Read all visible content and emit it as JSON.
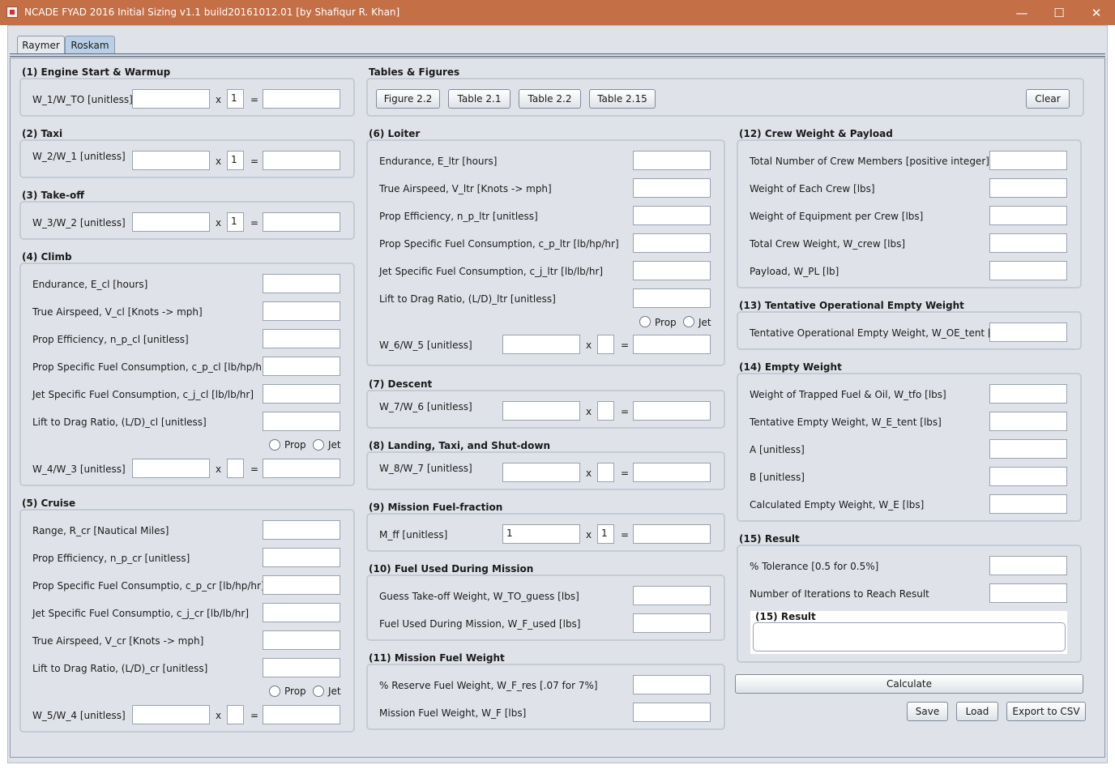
{
  "window": {
    "title": "NCADE FYAD 2016 Initial Sizing v1.1 build20161012.01 [by Shafiqur R. Khan]",
    "app_icon": "java-icon",
    "minimize_glyph": "—",
    "maximize_glyph": "☐",
    "close_glyph": "✕"
  },
  "tabs": [
    "Raymer",
    "Roskam"
  ],
  "active_tab": "Roskam",
  "s1": {
    "title": "(1) Engine Start & Warmup",
    "ratio_label": "W_1/W_TO [unitless]",
    "guess": "",
    "mult": "1",
    "result": ""
  },
  "s2": {
    "title": "(2) Taxi",
    "ratio_label": "W_2/W_1 [unitless]",
    "guess": "",
    "mult": "1",
    "result": ""
  },
  "s3": {
    "title": "(3) Take-off",
    "ratio_label": "W_3/W_2 [unitless]",
    "guess": "",
    "mult": "1",
    "result": ""
  },
  "s4": {
    "title": "(4) Climb",
    "rows": [
      {
        "label": "Endurance, E_cl [hours]",
        "value": ""
      },
      {
        "label": "True Airspeed, V_cl [Knots -> mph]",
        "value": ""
      },
      {
        "label": "Prop Efficiency, n_p_cl [unitless]",
        "value": ""
      },
      {
        "label": "Prop Specific Fuel Consumption, c_p_cl [lb/hp/hr]",
        "value": ""
      },
      {
        "label": "Jet Specific Fuel Consumption, c_j_cl [lb/lb/hr]",
        "value": ""
      },
      {
        "label": "Lift to Drag Ratio, (L/D)_cl [unitless]",
        "value": ""
      }
    ],
    "prop": "Prop",
    "jet": "Jet",
    "ratio_label": "W_4/W_3 [unitless]",
    "guess": "",
    "mult": "",
    "result": ""
  },
  "s5": {
    "title": "(5) Cruise",
    "rows": [
      {
        "label": "Range, R_cr [Nautical Miles]",
        "value": ""
      },
      {
        "label": "Prop Efficiency, n_p_cr [unitless]",
        "value": ""
      },
      {
        "label": "Prop Specific Fuel Consumptio, c_p_cr [lb/hp/hr]",
        "value": ""
      },
      {
        "label": "Jet Specific Fuel Consumptio, c_j_cr [lb/lb/hr]",
        "value": ""
      },
      {
        "label": "True Airspeed, V_cr [Knots -> mph]",
        "value": ""
      },
      {
        "label": "Lift to Drag Ratio, (L/D)_cr [unitless]",
        "value": ""
      }
    ],
    "prop": "Prop",
    "jet": "Jet",
    "ratio_label": "W_5/W_4 [unitless]",
    "guess": "",
    "mult": "",
    "result": ""
  },
  "tables": {
    "title": "Tables & Figures",
    "buttons": [
      "Figure 2.2",
      "Table 2.1",
      "Table 2.2",
      "Table 2.15"
    ],
    "clear": "Clear"
  },
  "s6": {
    "title": "(6) Loiter",
    "rows": [
      {
        "label": "Endurance, E_ltr [hours]",
        "value": ""
      },
      {
        "label": "True Airspeed, V_ltr [Knots -> mph]",
        "value": ""
      },
      {
        "label": "Prop Efficiency, n_p_ltr [unitless]",
        "value": ""
      },
      {
        "label": "Prop Specific Fuel Consumption, c_p_ltr [lb/hp/hr]",
        "value": ""
      },
      {
        "label": "Jet Specific Fuel Consumption, c_j_ltr [lb/lb/hr]",
        "value": ""
      },
      {
        "label": "Lift to Drag Ratio, (L/D)_ltr [unitless]",
        "value": ""
      }
    ],
    "prop": "Prop",
    "jet": "Jet",
    "ratio_label": "W_6/W_5 [unitless]",
    "guess": "",
    "mult": "",
    "result": ""
  },
  "s7": {
    "title": "(7) Descent",
    "ratio_label": "W_7/W_6 [unitless]",
    "guess": "",
    "mult": "",
    "result": ""
  },
  "s8": {
    "title": "(8) Landing, Taxi, and Shut-down",
    "ratio_label": "W_8/W_7 [unitless]",
    "guess": "",
    "mult": "",
    "result": ""
  },
  "s9": {
    "title": "(9) Mission Fuel-fraction",
    "ratio_label": "M_ff [unitless]",
    "guess": "1",
    "mult": "1",
    "result": ""
  },
  "s10": {
    "title": "(10) Fuel Used During Mission",
    "rows": [
      {
        "label": "Guess Take-off Weight, W_TO_guess [lbs]",
        "value": ""
      },
      {
        "label": "Fuel Used During Mission, W_F_used [lbs]",
        "value": ""
      }
    ]
  },
  "s11": {
    "title": "(11) Mission Fuel Weight",
    "rows": [
      {
        "label": "% Reserve Fuel Weight, W_F_res [.07 for 7%]",
        "value": ""
      },
      {
        "label": "Mission Fuel Weight, W_F [lbs]",
        "value": ""
      }
    ]
  },
  "s12": {
    "title": "(12) Crew Weight & Payload",
    "rows": [
      {
        "label": "Total Number of Crew Members [positive integer]",
        "value": ""
      },
      {
        "label": "Weight of Each Crew [lbs]",
        "value": ""
      },
      {
        "label": "Weight of Equipment per Crew [lbs]",
        "value": ""
      },
      {
        "label": "Total Crew Weight, W_crew [lbs]",
        "value": ""
      },
      {
        "label": "Payload, W_PL [lb]",
        "value": ""
      }
    ]
  },
  "s13": {
    "title": "(13) Tentative Operational Empty Weight",
    "rows": [
      {
        "label": "Tentative Operational Empty Weight, W_OE_tent [lbs]",
        "value": ""
      }
    ]
  },
  "s14": {
    "title": "(14) Empty Weight",
    "rows": [
      {
        "label": "Weight of Trapped Fuel & Oil, W_tfo [lbs]",
        "value": ""
      },
      {
        "label": "Tentative Empty Weight, W_E_tent [lbs]",
        "value": ""
      },
      {
        "label": "A [unitless]",
        "value": ""
      },
      {
        "label": "B [unitless]",
        "value": ""
      },
      {
        "label": "Calculated Empty Weight, W_E [lbs]",
        "value": ""
      }
    ]
  },
  "s15": {
    "title": "(15) Result",
    "rows": [
      {
        "label": "% Tolerance [0.5 for 0.5%]",
        "value": ""
      },
      {
        "label": "Number of Iterations to Reach Result",
        "value": ""
      }
    ],
    "result_title": "(15) Result",
    "result_value": ""
  },
  "actions": {
    "calculate": "Calculate",
    "save": "Save",
    "load": "Load",
    "export": "Export to CSV"
  },
  "multiply_sign": "x",
  "equals_sign": "="
}
